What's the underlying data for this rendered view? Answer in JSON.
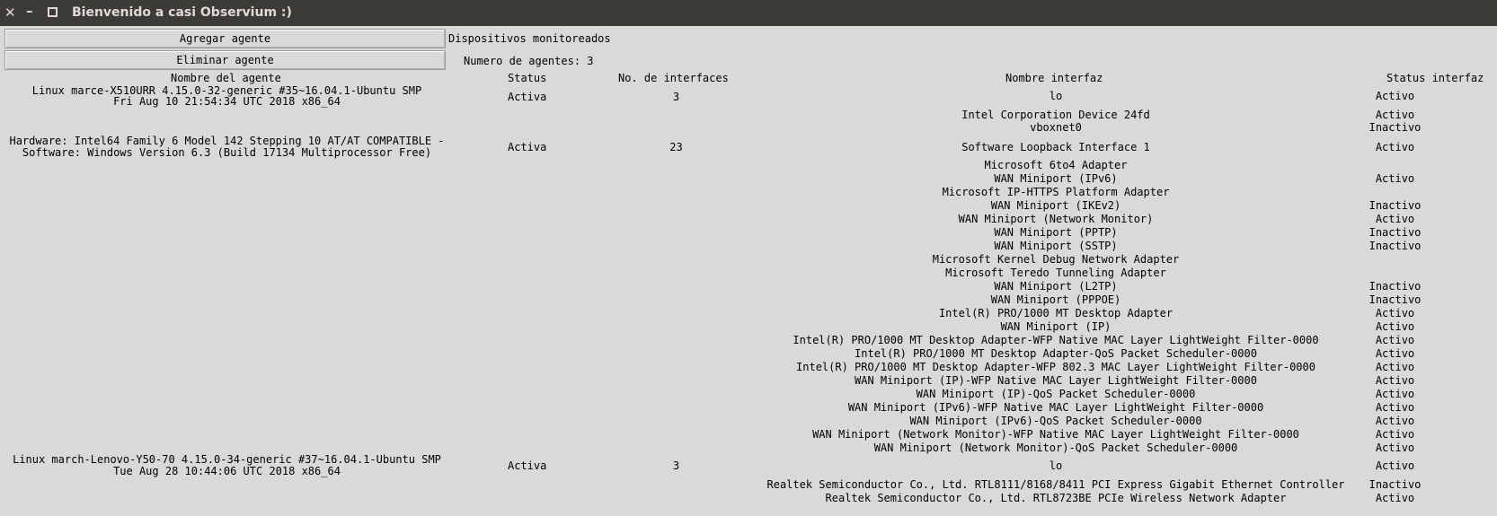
{
  "window": {
    "title": "Bienvenido a casi Observium :)",
    "close_glyph": "✕",
    "minimize_glyph": "–"
  },
  "toolbar": {
    "add_label": "Agregar agente",
    "remove_label": "Eliminar agente",
    "devices_label": "Dispositivos monitoreados",
    "agent_count_label": "Numero de agentes: 3"
  },
  "table": {
    "headers": {
      "agent": "Nombre del agente",
      "status": "Status",
      "count": "No. de interfaces",
      "iface": "Nombre interfaz",
      "istatus": "Status interfaz"
    },
    "agents": [
      {
        "line1": "Linux marce-X510URR 4.15.0-32-generic #35~16.04.1-Ubuntu SMP",
        "line2": "Fri Aug 10 21:54:34 UTC 2018 x86_64",
        "status": "Activa",
        "count": "3"
      },
      {
        "line1": "Hardware: Intel64 Family 6 Model 142 Stepping 10 AT/AT COMPATIBLE -",
        "line2": "Software: Windows Version 6.3 (Build 17134 Multiprocessor Free)",
        "status": "Activa",
        "count": "23"
      },
      {
        "line1": "Linux march-Lenovo-Y50-70 4.15.0-34-generic #37~16.04.1-Ubuntu SMP",
        "line2": "Tue Aug 28 10:44:06 UTC 2018 x86_64",
        "status": "Activa",
        "count": "3"
      }
    ],
    "interfaces": [
      {
        "name": "lo",
        "status": "Activo"
      },
      {
        "name": "Intel Corporation Device 24fd",
        "status": "Activo"
      },
      {
        "name": "vboxnet0",
        "status": "Inactivo"
      },
      {
        "name": "Software Loopback Interface 1",
        "status": "Activo"
      },
      {
        "name": "Microsoft 6to4 Adapter",
        "status": ""
      },
      {
        "name": "WAN Miniport (IPv6)",
        "status": "Activo"
      },
      {
        "name": "Microsoft IP-HTTPS Platform Adapter",
        "status": ""
      },
      {
        "name": "WAN Miniport (IKEv2)",
        "status": "Inactivo"
      },
      {
        "name": "WAN Miniport (Network Monitor)",
        "status": "Activo"
      },
      {
        "name": "WAN Miniport (PPTP)",
        "status": "Inactivo"
      },
      {
        "name": "WAN Miniport (SSTP)",
        "status": "Inactivo"
      },
      {
        "name": "Microsoft Kernel Debug Network Adapter",
        "status": ""
      },
      {
        "name": "Microsoft Teredo Tunneling Adapter",
        "status": ""
      },
      {
        "name": "WAN Miniport (L2TP)",
        "status": "Inactivo"
      },
      {
        "name": "WAN Miniport (PPPOE)",
        "status": "Inactivo"
      },
      {
        "name": "Intel(R) PRO/1000 MT Desktop Adapter",
        "status": "Activo"
      },
      {
        "name": "WAN Miniport (IP)",
        "status": "Activo"
      },
      {
        "name": "Intel(R) PRO/1000 MT Desktop Adapter-WFP Native MAC Layer LightWeight Filter-0000",
        "status": "Activo"
      },
      {
        "name": "Intel(R) PRO/1000 MT Desktop Adapter-QoS Packet Scheduler-0000",
        "status": "Activo"
      },
      {
        "name": "Intel(R) PRO/1000 MT Desktop Adapter-WFP 802.3 MAC Layer LightWeight Filter-0000",
        "status": "Activo"
      },
      {
        "name": "WAN Miniport (IP)-WFP Native MAC Layer LightWeight Filter-0000",
        "status": "Activo"
      },
      {
        "name": "WAN Miniport (IP)-QoS Packet Scheduler-0000",
        "status": "Activo"
      },
      {
        "name": "WAN Miniport (IPv6)-WFP Native MAC Layer LightWeight Filter-0000",
        "status": "Activo"
      },
      {
        "name": "WAN Miniport (IPv6)-QoS Packet Scheduler-0000",
        "status": "Activo"
      },
      {
        "name": "WAN Miniport (Network Monitor)-WFP Native MAC Layer LightWeight Filter-0000",
        "status": "Activo"
      },
      {
        "name": "WAN Miniport (Network Monitor)-QoS Packet Scheduler-0000",
        "status": "Activo"
      },
      {
        "name": "lo",
        "status": "Activo"
      },
      {
        "name": "Realtek Semiconductor Co., Ltd. RTL8111/8168/8411 PCI Express Gigabit Ethernet Controller",
        "status": "Inactivo"
      },
      {
        "name": "Realtek Semiconductor Co., Ltd. RTL8723BE PCIe Wireless Network Adapter",
        "status": "Activo"
      }
    ]
  }
}
